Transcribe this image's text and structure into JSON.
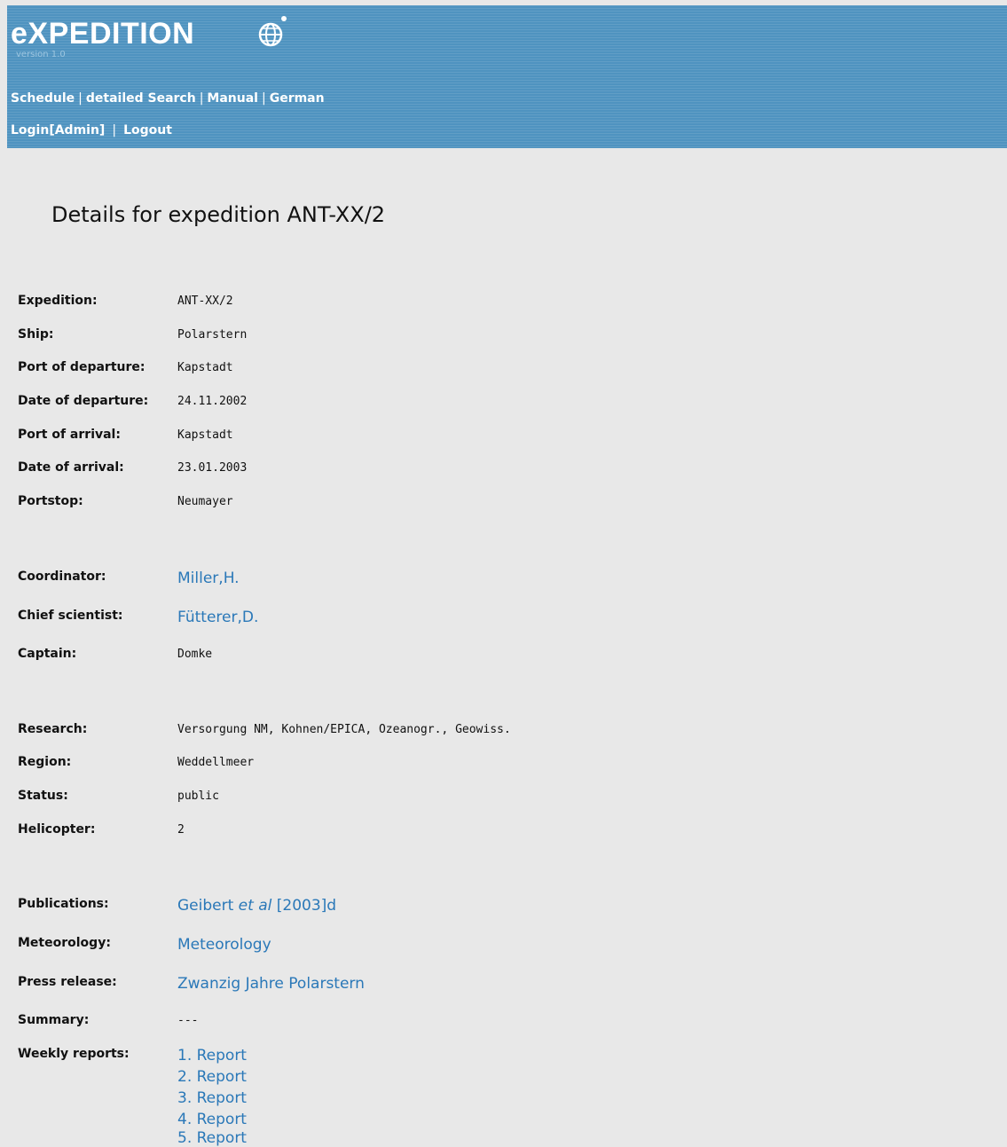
{
  "header": {
    "logo_text": "eXPEDITION",
    "logo_icon": "globe-icon",
    "version": "version 1.0",
    "nav_links": [
      "Schedule",
      "detailed Search",
      "Manual",
      "German"
    ],
    "nav_separator": "|",
    "login_link": "Login[Admin]",
    "logout_link": "Logout",
    "background_color": "#4f93c0"
  },
  "page": {
    "title": "Details for expedition ANT-XX/2"
  },
  "details": {
    "expedition": {
      "label": "Expedition:",
      "value": "ANT-XX/2"
    },
    "ship": {
      "label": "Ship:",
      "value": "Polarstern"
    },
    "port_of_departure": {
      "label": "Port of departure:",
      "value": "Kapstadt"
    },
    "date_of_departure": {
      "label": "Date of departure:",
      "value": "24.11.2002"
    },
    "port_of_arrival": {
      "label": "Port of arrival:",
      "value": "Kapstadt"
    },
    "date_of_arrival": {
      "label": "Date of arrival:",
      "value": "23.01.2003"
    },
    "portstop": {
      "label": "Portstop:",
      "value": "Neumayer"
    },
    "coordinator": {
      "label": "Coordinator:",
      "value": "Miller,H."
    },
    "chief_scientist": {
      "label": "Chief scientist:",
      "value": "Fütterer,D."
    },
    "captain": {
      "label": "Captain:",
      "value": "Domke"
    },
    "research": {
      "label": "Research:",
      "value": "Versorgung NM, Kohnen/EPICA, Ozeanogr., Geowiss."
    },
    "region": {
      "label": "Region:",
      "value": "Weddellmeer"
    },
    "status": {
      "label": "Status:",
      "value": "public"
    },
    "helicopter": {
      "label": "Helicopter:",
      "value": "2"
    },
    "publications": {
      "label": "Publications:",
      "author": "Geibert",
      "et_al": "et al",
      "year": "[2003]d"
    },
    "meteorology": {
      "label": "Meteorology:",
      "value": "Meteorology"
    },
    "press_release": {
      "label": "Press release:",
      "value": "Zwanzig Jahre Polarstern"
    },
    "summary": {
      "label": "Summary:",
      "value": "---"
    },
    "weekly_reports": {
      "label": "Weekly reports:",
      "items": [
        "1. Report",
        "2. Report",
        "3. Report",
        "4. Report",
        "5. Report"
      ]
    }
  },
  "colors": {
    "link": "#2a78b8",
    "page_background": "#e8e8e8"
  }
}
